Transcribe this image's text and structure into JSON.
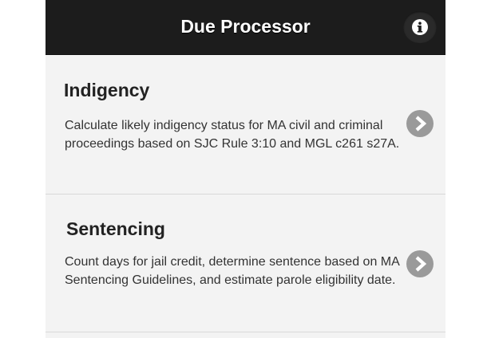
{
  "header": {
    "title": "Due Processor",
    "info_icon": "info-icon"
  },
  "items": [
    {
      "title": "Indigency",
      "description": "Calculate likely indigency status for MA civil and criminal proceedings based on SJC Rule 3:10 and MGL c261 s27A.",
      "icon": "chevron-right-icon"
    },
    {
      "title": "Sentencing",
      "description": "Count days for jail credit, determine sentence based on MA Sentencing Guidelines, and estimate parole eligibility date.",
      "icon": "chevron-right-icon"
    }
  ],
  "colors": {
    "header_bg": "#1c1c1c",
    "list_bg": "#f3f3f3",
    "chevron_bg": "#9a9a9a"
  }
}
